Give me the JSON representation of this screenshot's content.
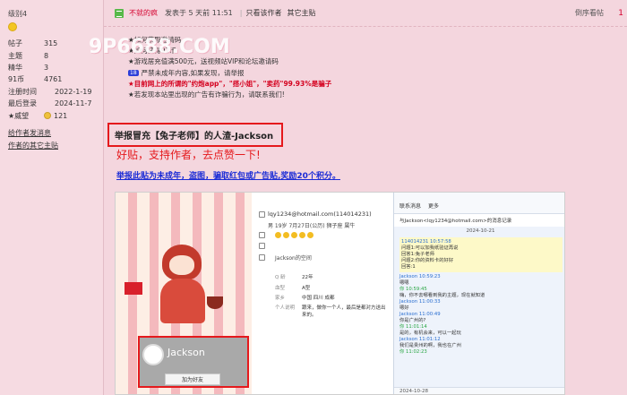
{
  "user": {
    "level": "级别4",
    "stats": [
      {
        "label": "帖子",
        "value": "315"
      },
      {
        "label": "主题",
        "value": "8"
      },
      {
        "label": "精华",
        "value": "3"
      },
      {
        "label": "91币",
        "value": "4761"
      },
      {
        "label": "注册时间",
        "value": "2022-1-19"
      },
      {
        "label": "最后登录",
        "value": "2024-11-7"
      },
      {
        "label": "★威望",
        "value": "121"
      }
    ],
    "links": [
      "给作者发消息",
      "作者的其它主贴"
    ]
  },
  "post_header": {
    "author": "不就的疯",
    "time": "发表于 5 天前 11:51",
    "separator": "|",
    "only_author": "只看该作者",
    "other_posts": "其它主贴",
    "order": "倒序看帖",
    "floor": "1"
  },
  "watermark": "9P6688.COM",
  "notices": [
    {
      "text": "★如何获取邀请码",
      "red": false
    },
    {
      "text": "★如何获得91币",
      "red": false
    },
    {
      "text": "★游戏居充值满500元，送视频站VIP和论坛邀请码",
      "red": false
    },
    {
      "text": "严禁未成年内容,如果发现，请举报",
      "red": false,
      "badge": "18"
    },
    {
      "text": "★目前网上的所谓的\"约炮app\"，\"搭小姐\"，\"卖药\"99.93%是骗子",
      "red": true
    },
    {
      "text": "★若发现本站里出现的广告有诈骗行为，请联系我们!",
      "red": false
    }
  ],
  "thread": {
    "title": "举报冒充【兔子老师】的人渣-Jackson",
    "support": "好贴，支持作者，去点赞一下!",
    "report": "举报此贴为未成年，盗图，骗取红包或广告贴,奖励20个积分。"
  },
  "screenshot": {
    "card_name": "Jackson",
    "add_friend": "加为好友",
    "email": "lqy1234@hotmail.com(114014231)",
    "line2": "男  19岁  7月27日(公历)  狮子座  属牛",
    "signature": "Jackson的空间",
    "details": [
      {
        "label": "Q 龄",
        "value": "22年"
      },
      {
        "label": "血型",
        "value": "A型"
      },
      {
        "label": "家乡",
        "value": "中国 四川 成都"
      },
      {
        "label": "个人说明",
        "value": "跟来，做你一个人，最后是都对方送出来的。"
      }
    ],
    "chat_tabs": [
      "联系消息",
      "更多"
    ],
    "chat_title": "与Jackson<lqy1234@hotmail.com>的消息记录",
    "chat_date": "2024-10-21",
    "highlight_name": "114014231 10:57:58",
    "highlight_lines": [
      "问题1:可以加我纸验证再说",
      "回答1:兔子老师",
      "问题2:你的资料卡的好好",
      "回答:1"
    ],
    "messages": [
      {
        "name": "Jackson 10:59:23",
        "text": "嗯嗯",
        "green": false
      },
      {
        "name": "你 10:59:45",
        "text": "嗨，你不去哪看到我的主题，现在就知道",
        "green": true
      },
      {
        "name": "Jackson 11:00:33",
        "text": "嗯好",
        "green": false
      },
      {
        "name": "Jackson 11:00:49",
        "text": "你是广州的?",
        "green": false
      },
      {
        "name": "你 11:01:14",
        "text": "是的，有机会来，可以一起玩",
        "green": true
      },
      {
        "name": "Jackson 11:01:12",
        "text": "我们是贵州的啊，我也在广州",
        "green": false
      },
      {
        "name": "你 11:02:23",
        "text": "",
        "green": true
      }
    ],
    "chat_foot": "2024-10-28"
  }
}
